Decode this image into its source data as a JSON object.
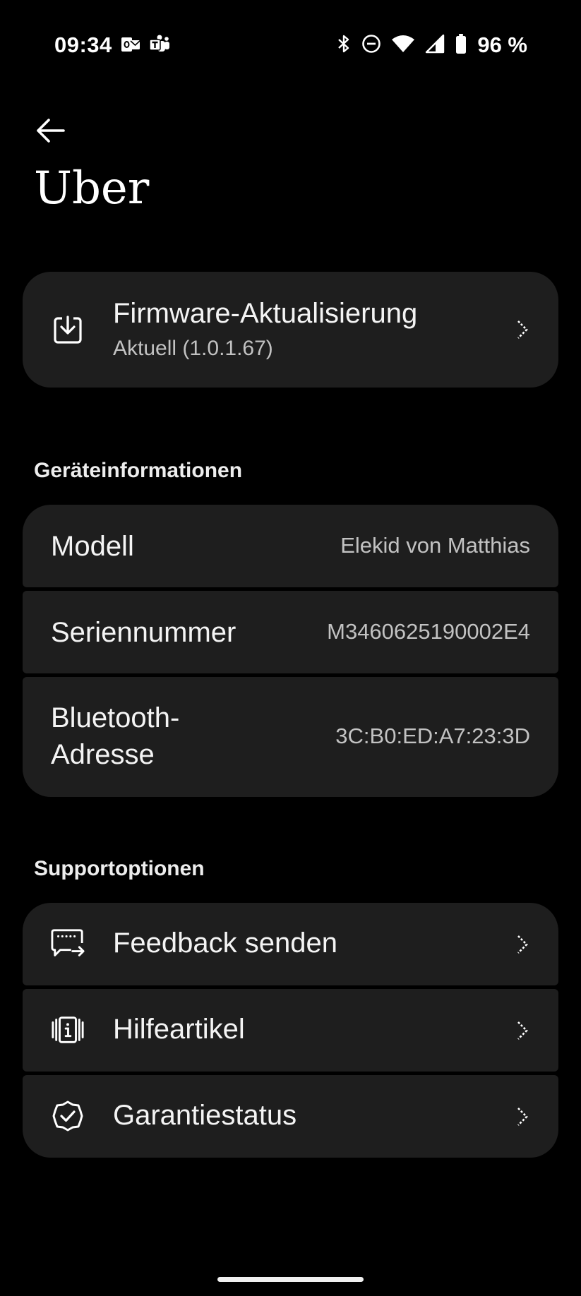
{
  "status_bar": {
    "time": "09:34",
    "left_icons": [
      "outlook-icon",
      "teams-icon"
    ],
    "right_icons": [
      "bluetooth-icon",
      "do-not-disturb-icon",
      "wifi-icon",
      "cellular-signal-icon",
      "battery-icon"
    ],
    "battery_percent": "96 %"
  },
  "header": {
    "back_icon": "arrow-left-icon",
    "title": "Uber"
  },
  "firmware": {
    "icon": "download-tray-icon",
    "title": "Firmware-Aktualisierung",
    "status": "Aktuell (1.0.1.67)"
  },
  "device_info": {
    "section_title": "Geräteinformationen",
    "rows": [
      {
        "label": "Modell",
        "value": "Elekid von Matthias"
      },
      {
        "label": "Seriennummer",
        "value": "M3460625190002E4"
      },
      {
        "label_line1": "Bluetooth-",
        "label_line2": "Adresse",
        "value": "3C:B0:ED:A7:23:3D"
      }
    ]
  },
  "support": {
    "section_title": "Supportoptionen",
    "items": [
      {
        "icon": "feedback-icon",
        "label": "Feedback senden"
      },
      {
        "icon": "help-article-icon",
        "label": "Hilfeartikel"
      },
      {
        "icon": "warranty-check-icon",
        "label": "Garantiestatus"
      }
    ]
  },
  "colors": {
    "background": "#000000",
    "card": "#1e1e1e",
    "primary_text": "#f4f4f4",
    "secondary_text": "#c2c2c2"
  }
}
